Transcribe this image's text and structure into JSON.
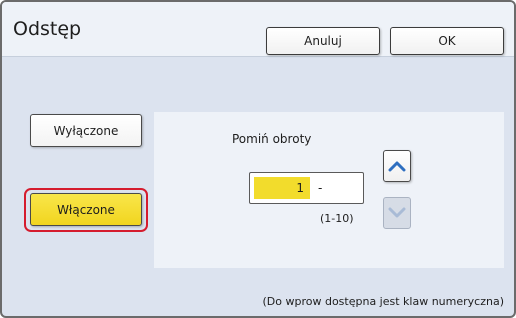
{
  "header": {
    "title": "Odstęp",
    "cancel_label": "Anuluj",
    "ok_label": "OK"
  },
  "modes": {
    "off_label": "Wyłączone",
    "on_label": "Włączone",
    "selected": "Włączone",
    "selected_color": "#f2dc2c",
    "highlight_color": "#d51c2e"
  },
  "rotation": {
    "label": "Pomiń obroty",
    "value": "1",
    "separator": "-",
    "range": "(1-10)",
    "up_icon": "chevron-up-icon",
    "down_icon": "chevron-down-icon"
  },
  "footer": {
    "note": "(Do wprow dostępna jest klaw numeryczna)"
  }
}
